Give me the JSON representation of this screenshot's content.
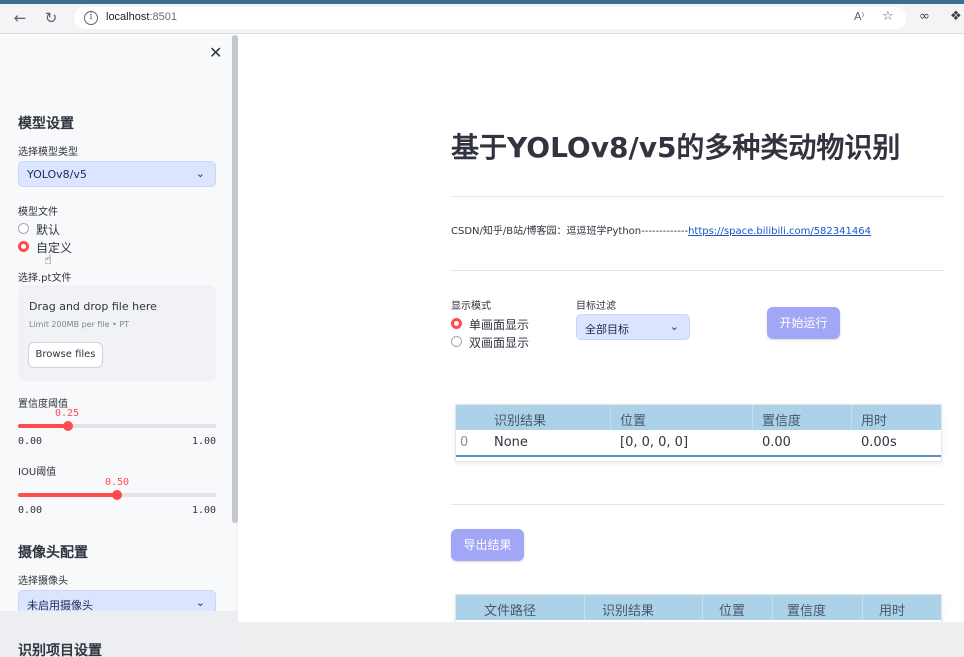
{
  "browser": {
    "url_host": "localhost",
    "url_port": ":8501"
  },
  "sidebar": {
    "model_section_title": "模型设置",
    "model_type_label": "选择模型类型",
    "model_type_value": "YOLOv8/v5",
    "model_file_label": "模型文件",
    "model_file_options": [
      "默认",
      "自定义"
    ],
    "model_file_selected": 1,
    "pt_file_label": "选择.pt文件",
    "uploader_drag_text": "Drag and drop file here",
    "uploader_limit_text": "Limit 200MB per file • PT",
    "browse_button": "Browse files",
    "conf_label": "置信度阈值",
    "conf_value": "0.25",
    "conf_min": "0.00",
    "conf_max": "1.00",
    "conf_fraction": 0.25,
    "iou_label": "IOU阈值",
    "iou_value": "0.50",
    "iou_min": "0.00",
    "iou_max": "1.00",
    "iou_fraction": 0.5,
    "camera_section_title": "摄像头配置",
    "camera_label": "选择摄像头",
    "camera_value": "未启用摄像头",
    "recognition_section_title": "识别项目设置"
  },
  "main": {
    "title": "基于YOLOv8/v5的多种类动物识别",
    "credit_text": "CSDN/知乎/B站/博客园：逗逗班学Python-------------",
    "credit_link": "https://space.bilibili.com/582341464",
    "display_mode_label": "显示模式",
    "display_mode_options": [
      "单画面显示",
      "双画面显示"
    ],
    "display_mode_selected": 0,
    "target_filter_label": "目标过滤",
    "target_filter_value": "全部目标",
    "run_button": "开始运行",
    "result_table": {
      "headers": [
        "识别结果",
        "位置",
        "置信度",
        "用时"
      ],
      "rows": [
        {
          "index": "0",
          "cells": [
            "None",
            "[0, 0, 0, 0]",
            "0.00",
            "0.00s"
          ]
        }
      ]
    },
    "export_button": "导出结果",
    "file_table": {
      "headers": [
        "文件路径",
        "识别结果",
        "位置",
        "置信度",
        "用时"
      ],
      "empty_text": "empty"
    }
  }
}
